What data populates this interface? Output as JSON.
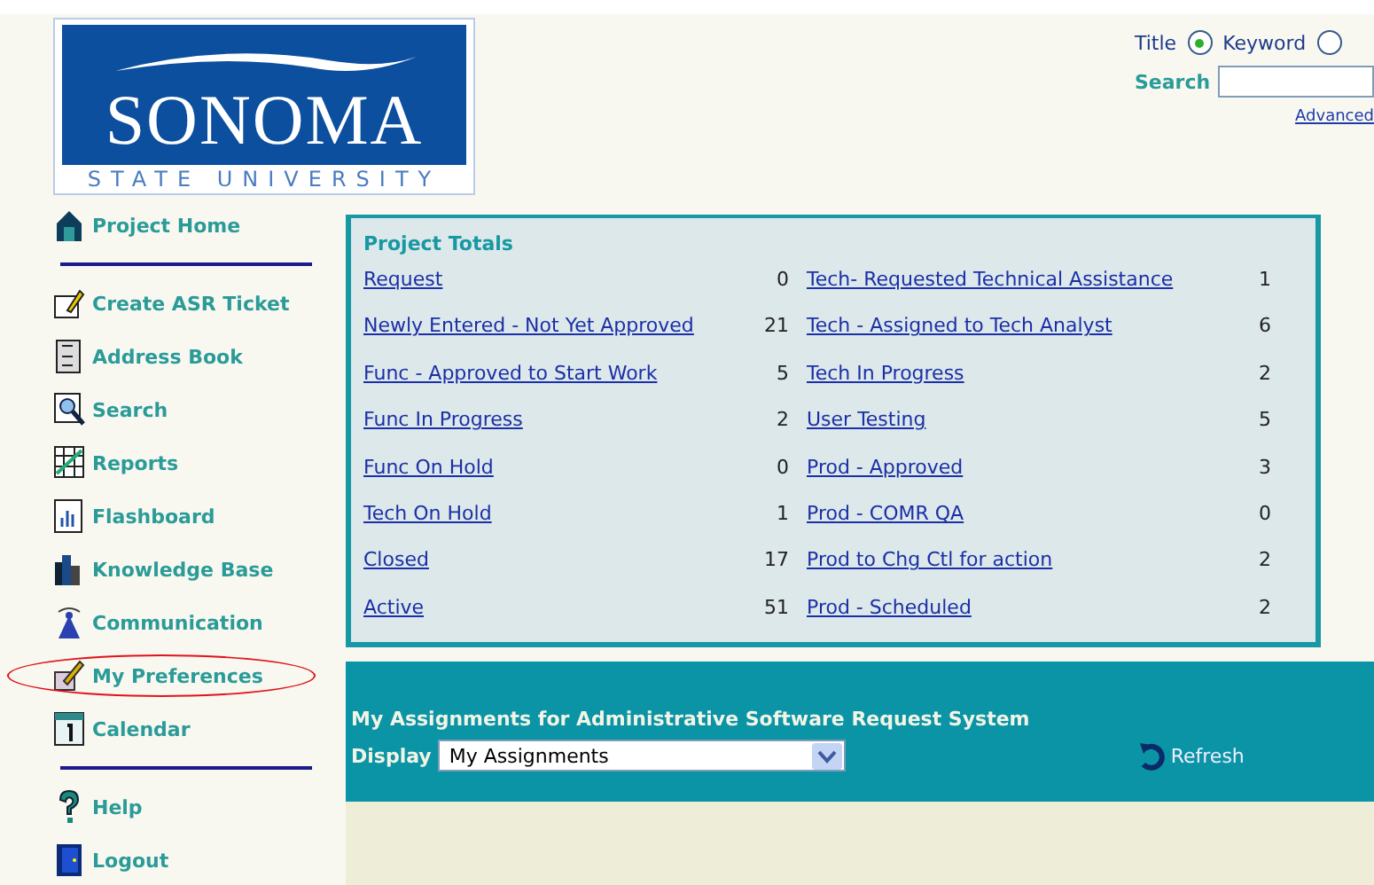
{
  "logo": {
    "name": "SONOMA",
    "subtitle": "STATE UNIVERSITY"
  },
  "search": {
    "modes": [
      {
        "label": "Title",
        "selected": true
      },
      {
        "label": "Keyword",
        "selected": false
      }
    ],
    "label": "Search",
    "advanced": "Advanced"
  },
  "sidebar": {
    "groups": [
      [
        {
          "label": "Project Home",
          "highlighted": false
        }
      ],
      [
        {
          "label": "Create ASR Ticket",
          "highlighted": false
        },
        {
          "label": "Address Book",
          "highlighted": false
        },
        {
          "label": "Search",
          "highlighted": false
        },
        {
          "label": "Reports",
          "highlighted": false
        },
        {
          "label": "Flashboard",
          "highlighted": false
        },
        {
          "label": "Knowledge Base",
          "highlighted": false
        },
        {
          "label": "Communication",
          "highlighted": false
        },
        {
          "label": "My Preferences",
          "highlighted": true
        },
        {
          "label": "Calendar",
          "highlighted": false
        }
      ],
      [
        {
          "label": "Help",
          "highlighted": false
        },
        {
          "label": "Logout",
          "highlighted": false
        }
      ]
    ]
  },
  "project_totals": {
    "title": "Project Totals",
    "columns": [
      [
        {
          "label": "Request",
          "count": "0"
        },
        {
          "label": "Newly Entered - Not Yet Approved",
          "count": "21"
        },
        {
          "label": "Func - Approved to Start Work",
          "count": "5"
        },
        {
          "label": "Func In Progress",
          "count": "2"
        },
        {
          "label": "Func On Hold",
          "count": "0"
        },
        {
          "label": "Tech On Hold",
          "count": "1"
        },
        {
          "label": "Closed",
          "count": "17"
        },
        {
          "label": "Active",
          "count": "51"
        }
      ],
      [
        {
          "label": "Tech- Requested Technical Assistance",
          "count": "1"
        },
        {
          "label": "Tech - Assigned to Tech Analyst",
          "count": "6"
        },
        {
          "label": "Tech In Progress",
          "count": "2"
        },
        {
          "label": "User Testing",
          "count": "5"
        },
        {
          "label": "Prod - Approved",
          "count": "3"
        },
        {
          "label": "Prod - COMR QA",
          "count": "0"
        },
        {
          "label": "Prod to Chg Ctl for action",
          "count": "2"
        },
        {
          "label": "Prod - Scheduled",
          "count": "2"
        }
      ]
    ]
  },
  "assignments": {
    "title": "My Assignments for Administrative Software Request System",
    "display_label": "Display",
    "display_value": "My Assignments",
    "refresh": "Refresh"
  }
}
